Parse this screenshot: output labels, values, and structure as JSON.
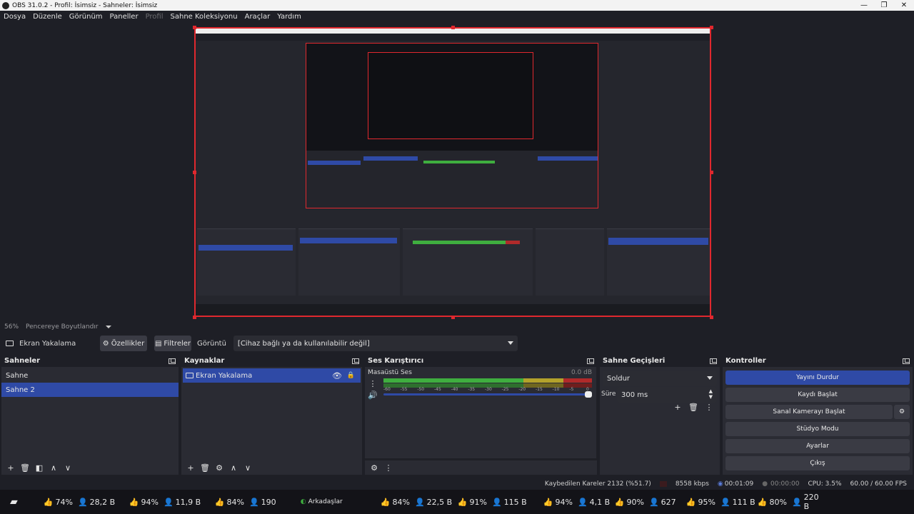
{
  "window": {
    "title": "OBS 31.0.2 - Profil: İsimsiz - Sahneler: İsimsiz",
    "minimize": "—",
    "maximize": "❐",
    "close": "✕"
  },
  "menu": [
    "Dosya",
    "Düzenle",
    "Görünüm",
    "Paneller",
    "Profil",
    "Sahne Koleksiyonu",
    "Araçlar",
    "Yardım"
  ],
  "menu_disabled": "Profil",
  "zoom": {
    "value": "56%",
    "label": "Pencereye Boyutlandır"
  },
  "source_bar": {
    "source_name": "Ekran Yakalama",
    "properties": "Özellikler",
    "filters": "Filtreler",
    "display_label": "Görüntü",
    "display_value": "[Cihaz bağlı ya da kullanılabilir değil]"
  },
  "scenes": {
    "title": "Sahneler",
    "items": [
      "Sahne",
      "Sahne 2"
    ],
    "selected": 1
  },
  "sources": {
    "title": "Kaynaklar",
    "items": [
      "Ekran Yakalama"
    ]
  },
  "mixer": {
    "title": "Ses Karıştırıcı",
    "channel": "Masaüstü Ses",
    "db": "0.0 dB",
    "ticks": [
      "-60",
      "-55",
      "-50",
      "-45",
      "-40",
      "-35",
      "-30",
      "-25",
      "-20",
      "-15",
      "-10",
      "-5",
      "0"
    ],
    "volume_fraction": 1.0
  },
  "transitions": {
    "title": "Sahne Geçişleri",
    "type": "Soldur",
    "duration_label": "Süre",
    "duration_value": "300 ms"
  },
  "controls": {
    "title": "Kontroller",
    "stop_stream": "Yayını Durdur",
    "start_record": "Kaydı Başlat",
    "start_vcam": "Sanal Kamerayı Başlat",
    "studio_mode": "Stüdyo Modu",
    "settings": "Ayarlar",
    "exit": "Çıkış"
  },
  "status": {
    "dropped": "Kaybedilen Kareler 2132 (%51.7)",
    "bitrate": "8558 kbps",
    "stream_time": "00:01:09",
    "record_time": "00:00:00",
    "cpu": "CPU: 3.5%",
    "fps": "60.00 / 60.00 FPS"
  },
  "taskbar": [
    {
      "likes": "74%",
      "users": "28,2 B"
    },
    {
      "likes": "94%",
      "users": "11,9 B"
    },
    {
      "likes": "84%",
      "users": "190"
    },
    {
      "friends": "Arkadaşlar"
    },
    {
      "likes": "84%",
      "users": "22,5 B"
    },
    {
      "likes": "91%",
      "users": "115 B"
    },
    {
      "likes": "94%",
      "users": "4,1 B"
    },
    {
      "likes": "90%",
      "users": "627"
    },
    {
      "likes": "95%",
      "users": "111 B"
    },
    {
      "likes": "80%",
      "users": "220 B"
    }
  ],
  "colors": {
    "accent": "#2f4aa6",
    "selection_red": "#e0282e",
    "meter_green": "#3fae3f",
    "meter_yellow": "#b3a22b",
    "meter_red": "#b02a2a"
  }
}
